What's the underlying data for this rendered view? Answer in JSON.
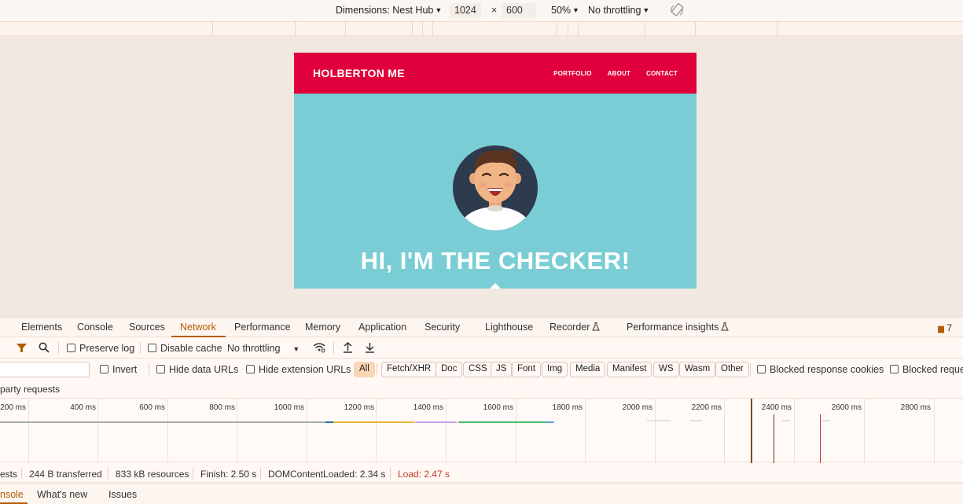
{
  "device_toolbar": {
    "dimensions_label": "Dimensions: Nest Hub",
    "width": "1024",
    "times": "×",
    "height": "600",
    "zoom": "50%",
    "throttling": "No throttling"
  },
  "site": {
    "brand": "HOLBERTON ME",
    "nav": [
      "PORTFOLIO",
      "ABOUT",
      "CONTACT"
    ],
    "hero_title": "HI, I'M THE CHECKER!"
  },
  "devtools": {
    "tabs": [
      "Elements",
      "Console",
      "Sources",
      "Network",
      "Performance",
      "Memory",
      "Application",
      "Security",
      "Lighthouse",
      "Recorder",
      "Performance insights"
    ],
    "active_tab": "Network",
    "issues_count": "7",
    "toolbar": {
      "preserve_log": "Preserve log",
      "disable_cache": "Disable cache",
      "throttling": "No throttling"
    },
    "filter": {
      "invert": "Invert",
      "hide_data_urls": "Hide data URLs",
      "hide_extension_urls": "Hide extension URLs",
      "types": [
        "All",
        "Fetch/XHR",
        "Doc",
        "CSS",
        "JS",
        "Font",
        "Img",
        "Media",
        "Manifest",
        "WS",
        "Wasm",
        "Other"
      ],
      "active_type": "All",
      "blocked_response_cookies": "Blocked response cookies",
      "blocked_requests": "Blocked reque",
      "third_party": "party requests"
    },
    "timeline": {
      "labels": [
        "200 ms",
        "400 ms",
        "600 ms",
        "800 ms",
        "1000 ms",
        "1200 ms",
        "1400 ms",
        "1600 ms",
        "1800 ms",
        "2000 ms",
        "2200 ms",
        "2400 ms",
        "2600 ms",
        "2800 ms"
      ]
    },
    "status": {
      "requests": "ests",
      "transferred": "244 B transferred",
      "resources": "833 kB resources",
      "finish": "Finish: 2.50 s",
      "dom_content_loaded": "DOMContentLoaded: 2.34 s",
      "load": "Load: 2.47 s"
    },
    "drawer_tabs": [
      "nsole",
      "What's new",
      "Issues"
    ]
  },
  "colors": {
    "nav_red": "#e0003b",
    "hero_teal": "#7acdd4",
    "devtools_accent": "#b35c00"
  }
}
